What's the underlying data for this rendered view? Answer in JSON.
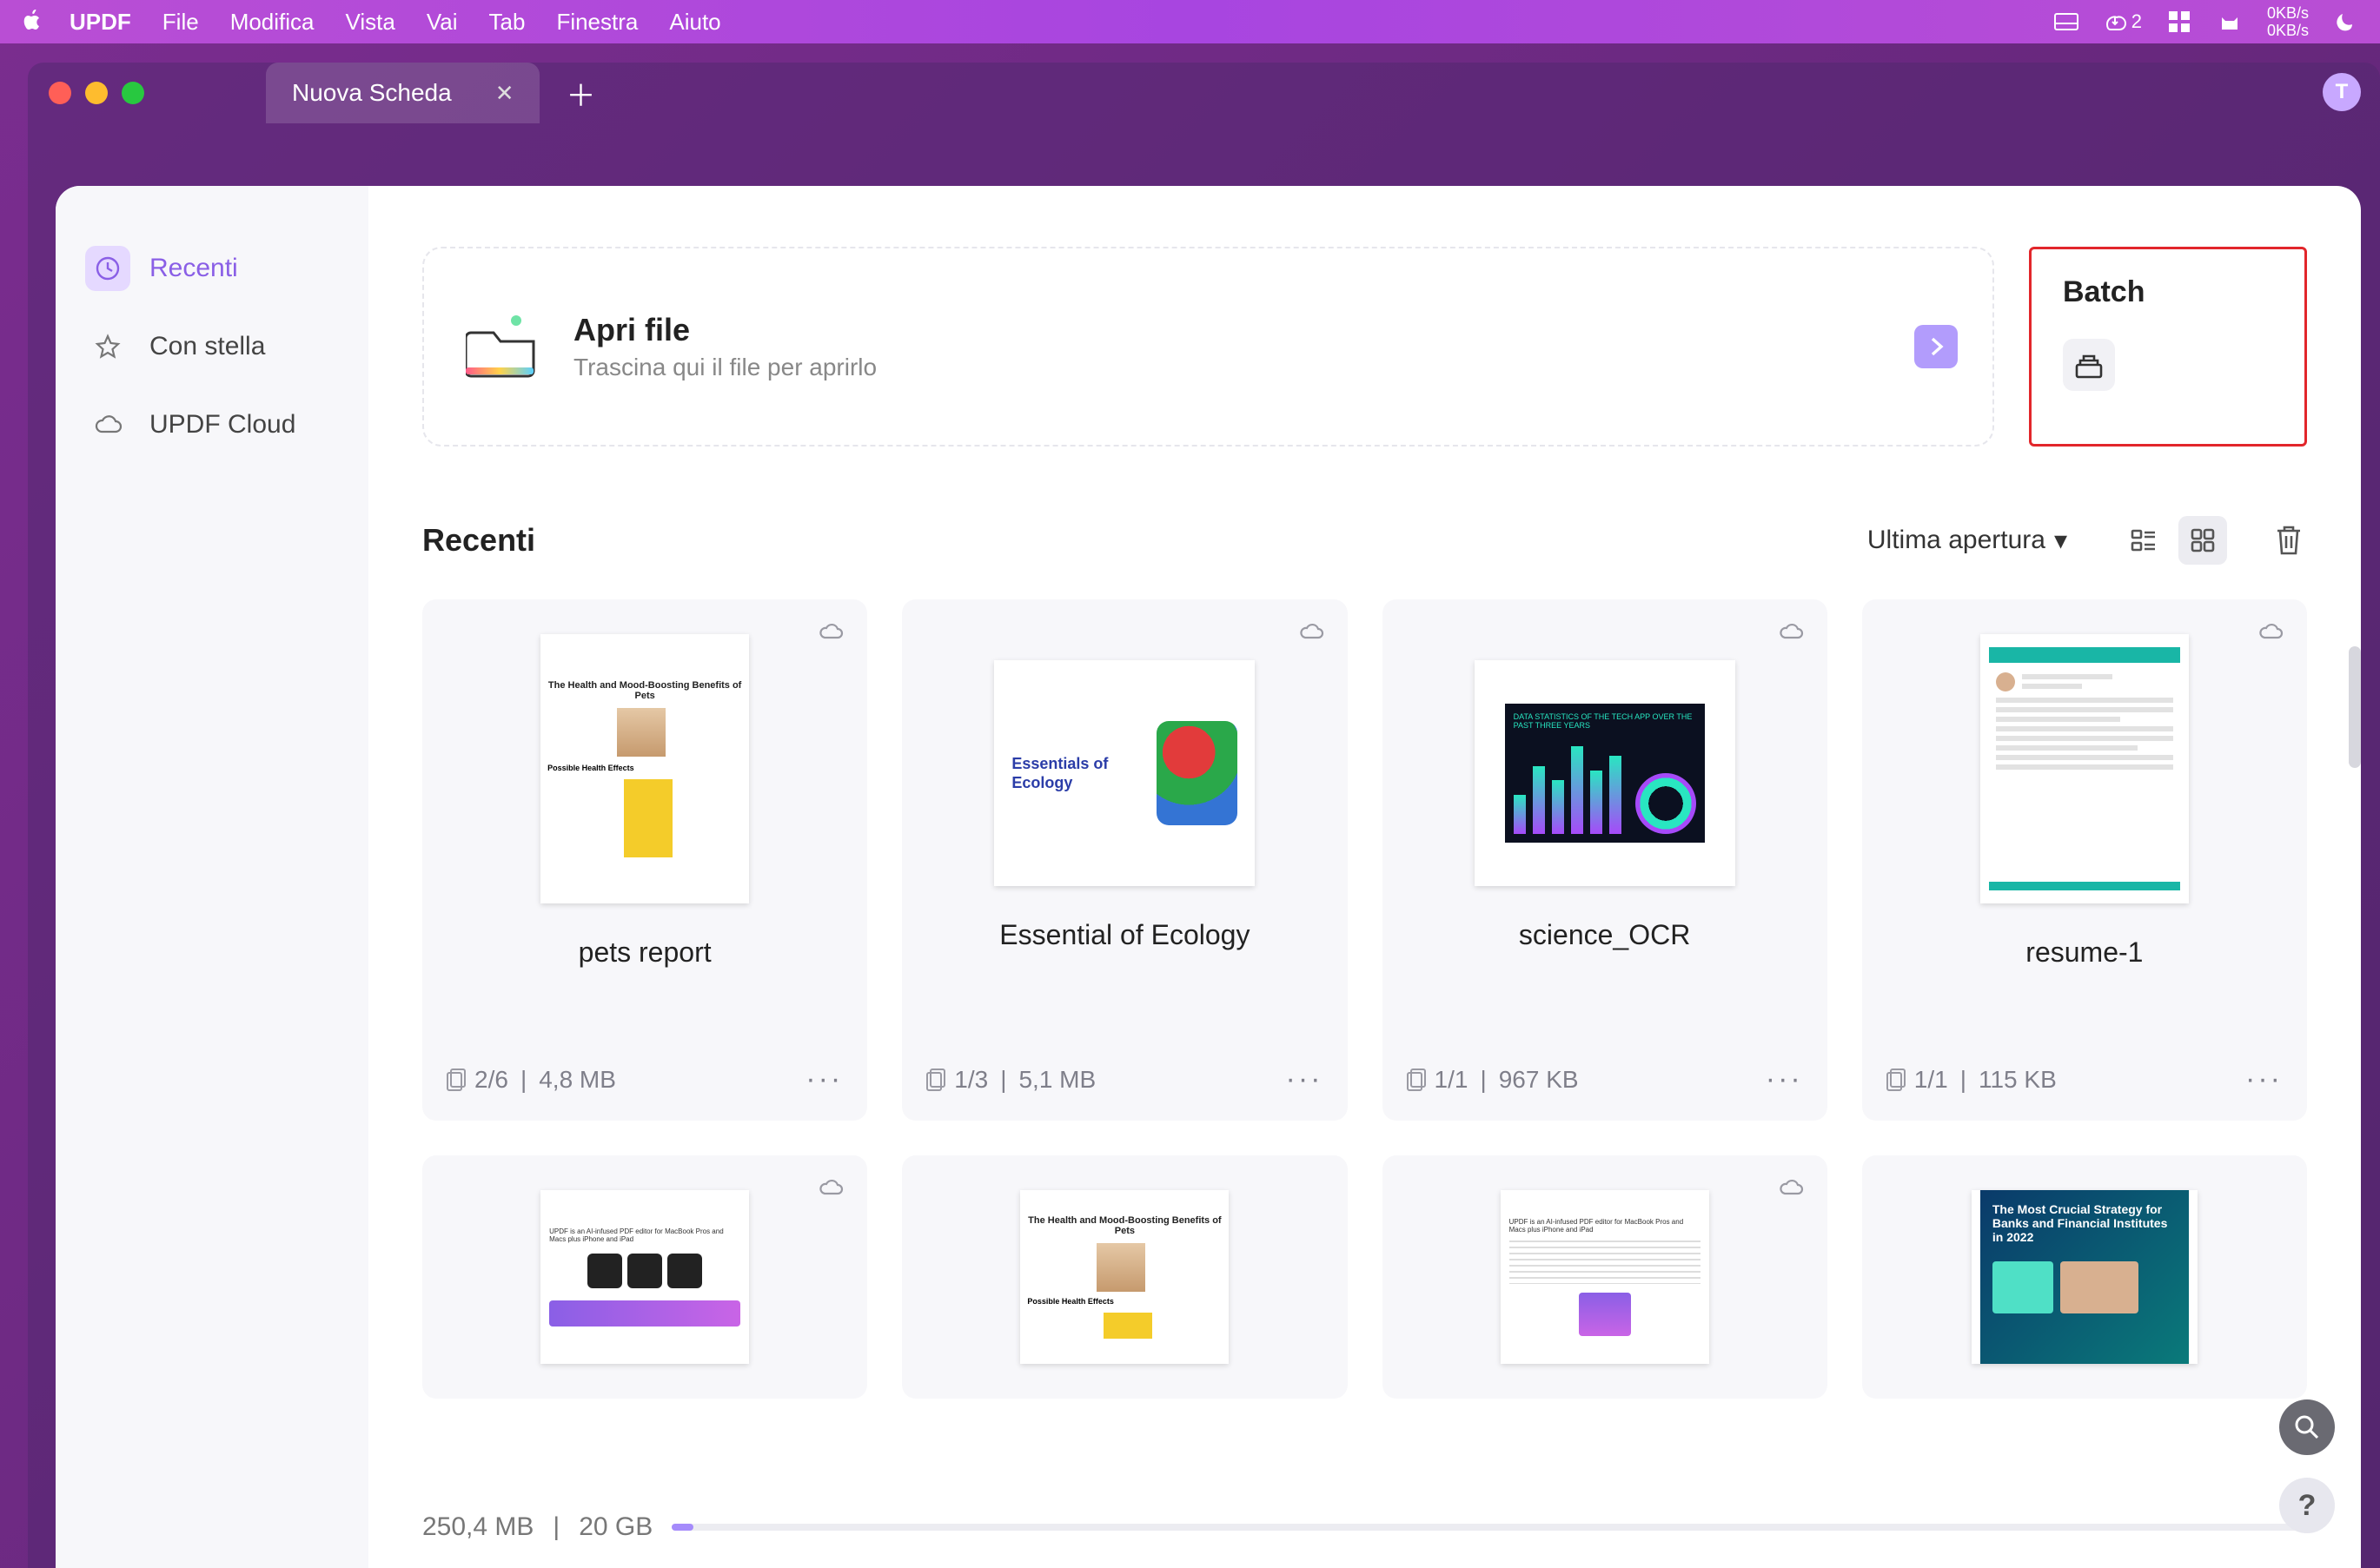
{
  "menubar": {
    "app": "UPDF",
    "items": [
      "File",
      "Modifica",
      "Vista",
      "Vai",
      "Tab",
      "Finestra",
      "Aiuto"
    ],
    "download_count": "2",
    "speed_up": "0KB/s",
    "speed_down": "0KB/s"
  },
  "window": {
    "tab_title": "Nuova Scheda",
    "avatar_letter": "T"
  },
  "sidebar": {
    "items": [
      {
        "label": "Recenti",
        "active": true,
        "icon": "clock"
      },
      {
        "label": "Con stella",
        "active": false,
        "icon": "star"
      },
      {
        "label": "UPDF Cloud",
        "active": false,
        "icon": "cloud"
      }
    ]
  },
  "open_card": {
    "title": "Apri file",
    "subtitle": "Trascina qui il file per aprirlo"
  },
  "batch_card": {
    "title": "Batch"
  },
  "recent": {
    "title": "Recenti",
    "sort_label": "Ultima apertura"
  },
  "files": [
    {
      "name": "pets report",
      "pages": "2/6",
      "size": "4,8 MB",
      "cloud": true,
      "thumb": "pets"
    },
    {
      "name": "Essential of Ecology",
      "pages": "1/3",
      "size": "5,1 MB",
      "cloud": true,
      "thumb": "eco"
    },
    {
      "name": "science_OCR",
      "pages": "1/1",
      "size": "967 KB",
      "cloud": true,
      "thumb": "sci"
    },
    {
      "name": "resume-1",
      "pages": "1/1",
      "size": "115 KB",
      "cloud": true,
      "thumb": "res"
    }
  ],
  "files_row2": [
    {
      "thumb": "updf",
      "cloud": true
    },
    {
      "thumb": "pets",
      "cloud": false
    },
    {
      "thumb": "updf2",
      "cloud": true
    },
    {
      "thumb": "bank",
      "cloud": false
    }
  ],
  "thumb_text": {
    "pets_title": "The Health and Mood-Boosting Benefits of Pets",
    "eco_title": "Essentials of Ecology",
    "bank_title": "The Most Crucial Strategy for Banks and Financial Institutes in 2022"
  },
  "storage": {
    "used": "250,4 MB",
    "total": "20 GB"
  }
}
